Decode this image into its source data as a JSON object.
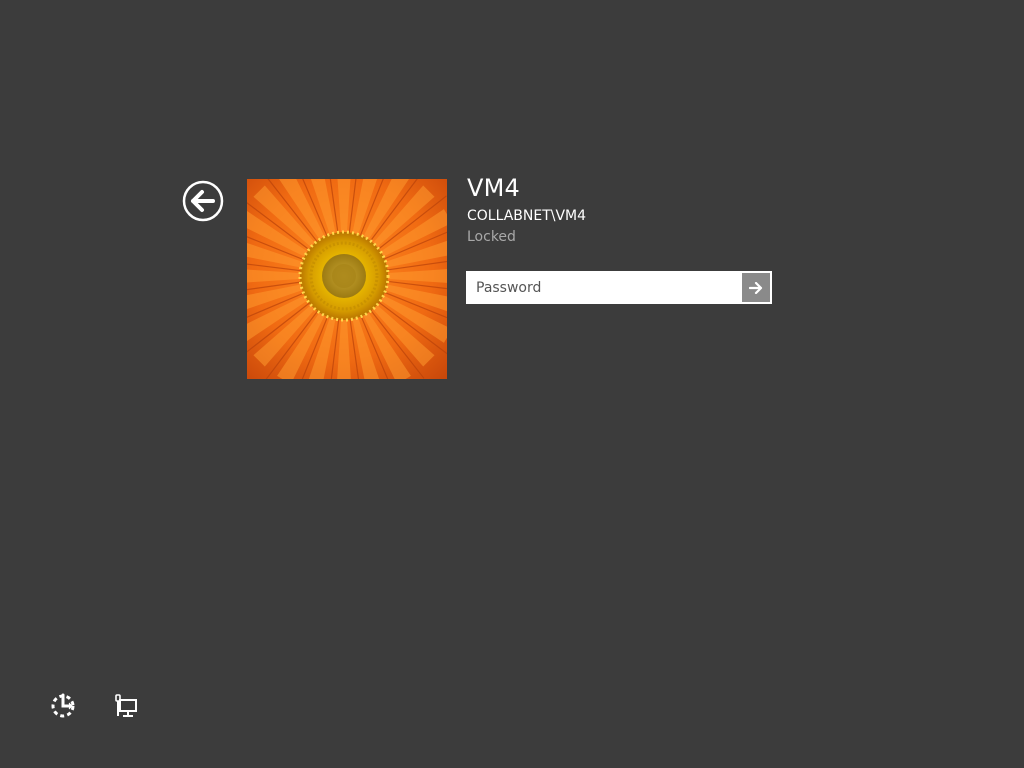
{
  "user": {
    "name": "VM4",
    "account": "COLLABNET\\VM4",
    "status": "Locked"
  },
  "password": {
    "placeholder": "Password",
    "value": ""
  },
  "icons": {
    "back": "back-arrow-icon",
    "submit": "arrow-right-icon",
    "ease_of_access": "ease-of-access-icon",
    "network": "network-icon",
    "avatar": "flower-avatar"
  },
  "colors": {
    "background": "#3c3c3c",
    "avatar_petal": "#f06a12",
    "avatar_center": "#e8b800",
    "submit_button": "#8a8a8a",
    "status_text": "#a8a8a8"
  }
}
